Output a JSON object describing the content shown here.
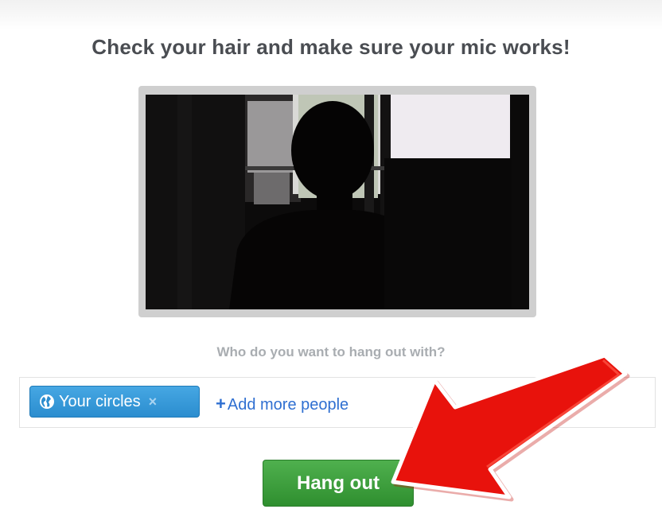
{
  "heading": "Check your hair and make sure your mic works!",
  "prompt": "Who do you want to hang out with?",
  "people": {
    "chip_label": "Your circles",
    "chip_remove": "×",
    "add_plus": "+",
    "add_label": "Add more people"
  },
  "hangout_button": "Hang out",
  "colors": {
    "chip": "#2b8dcf",
    "button": "#3a9a3a",
    "annotation_arrow": "#e8120c"
  }
}
